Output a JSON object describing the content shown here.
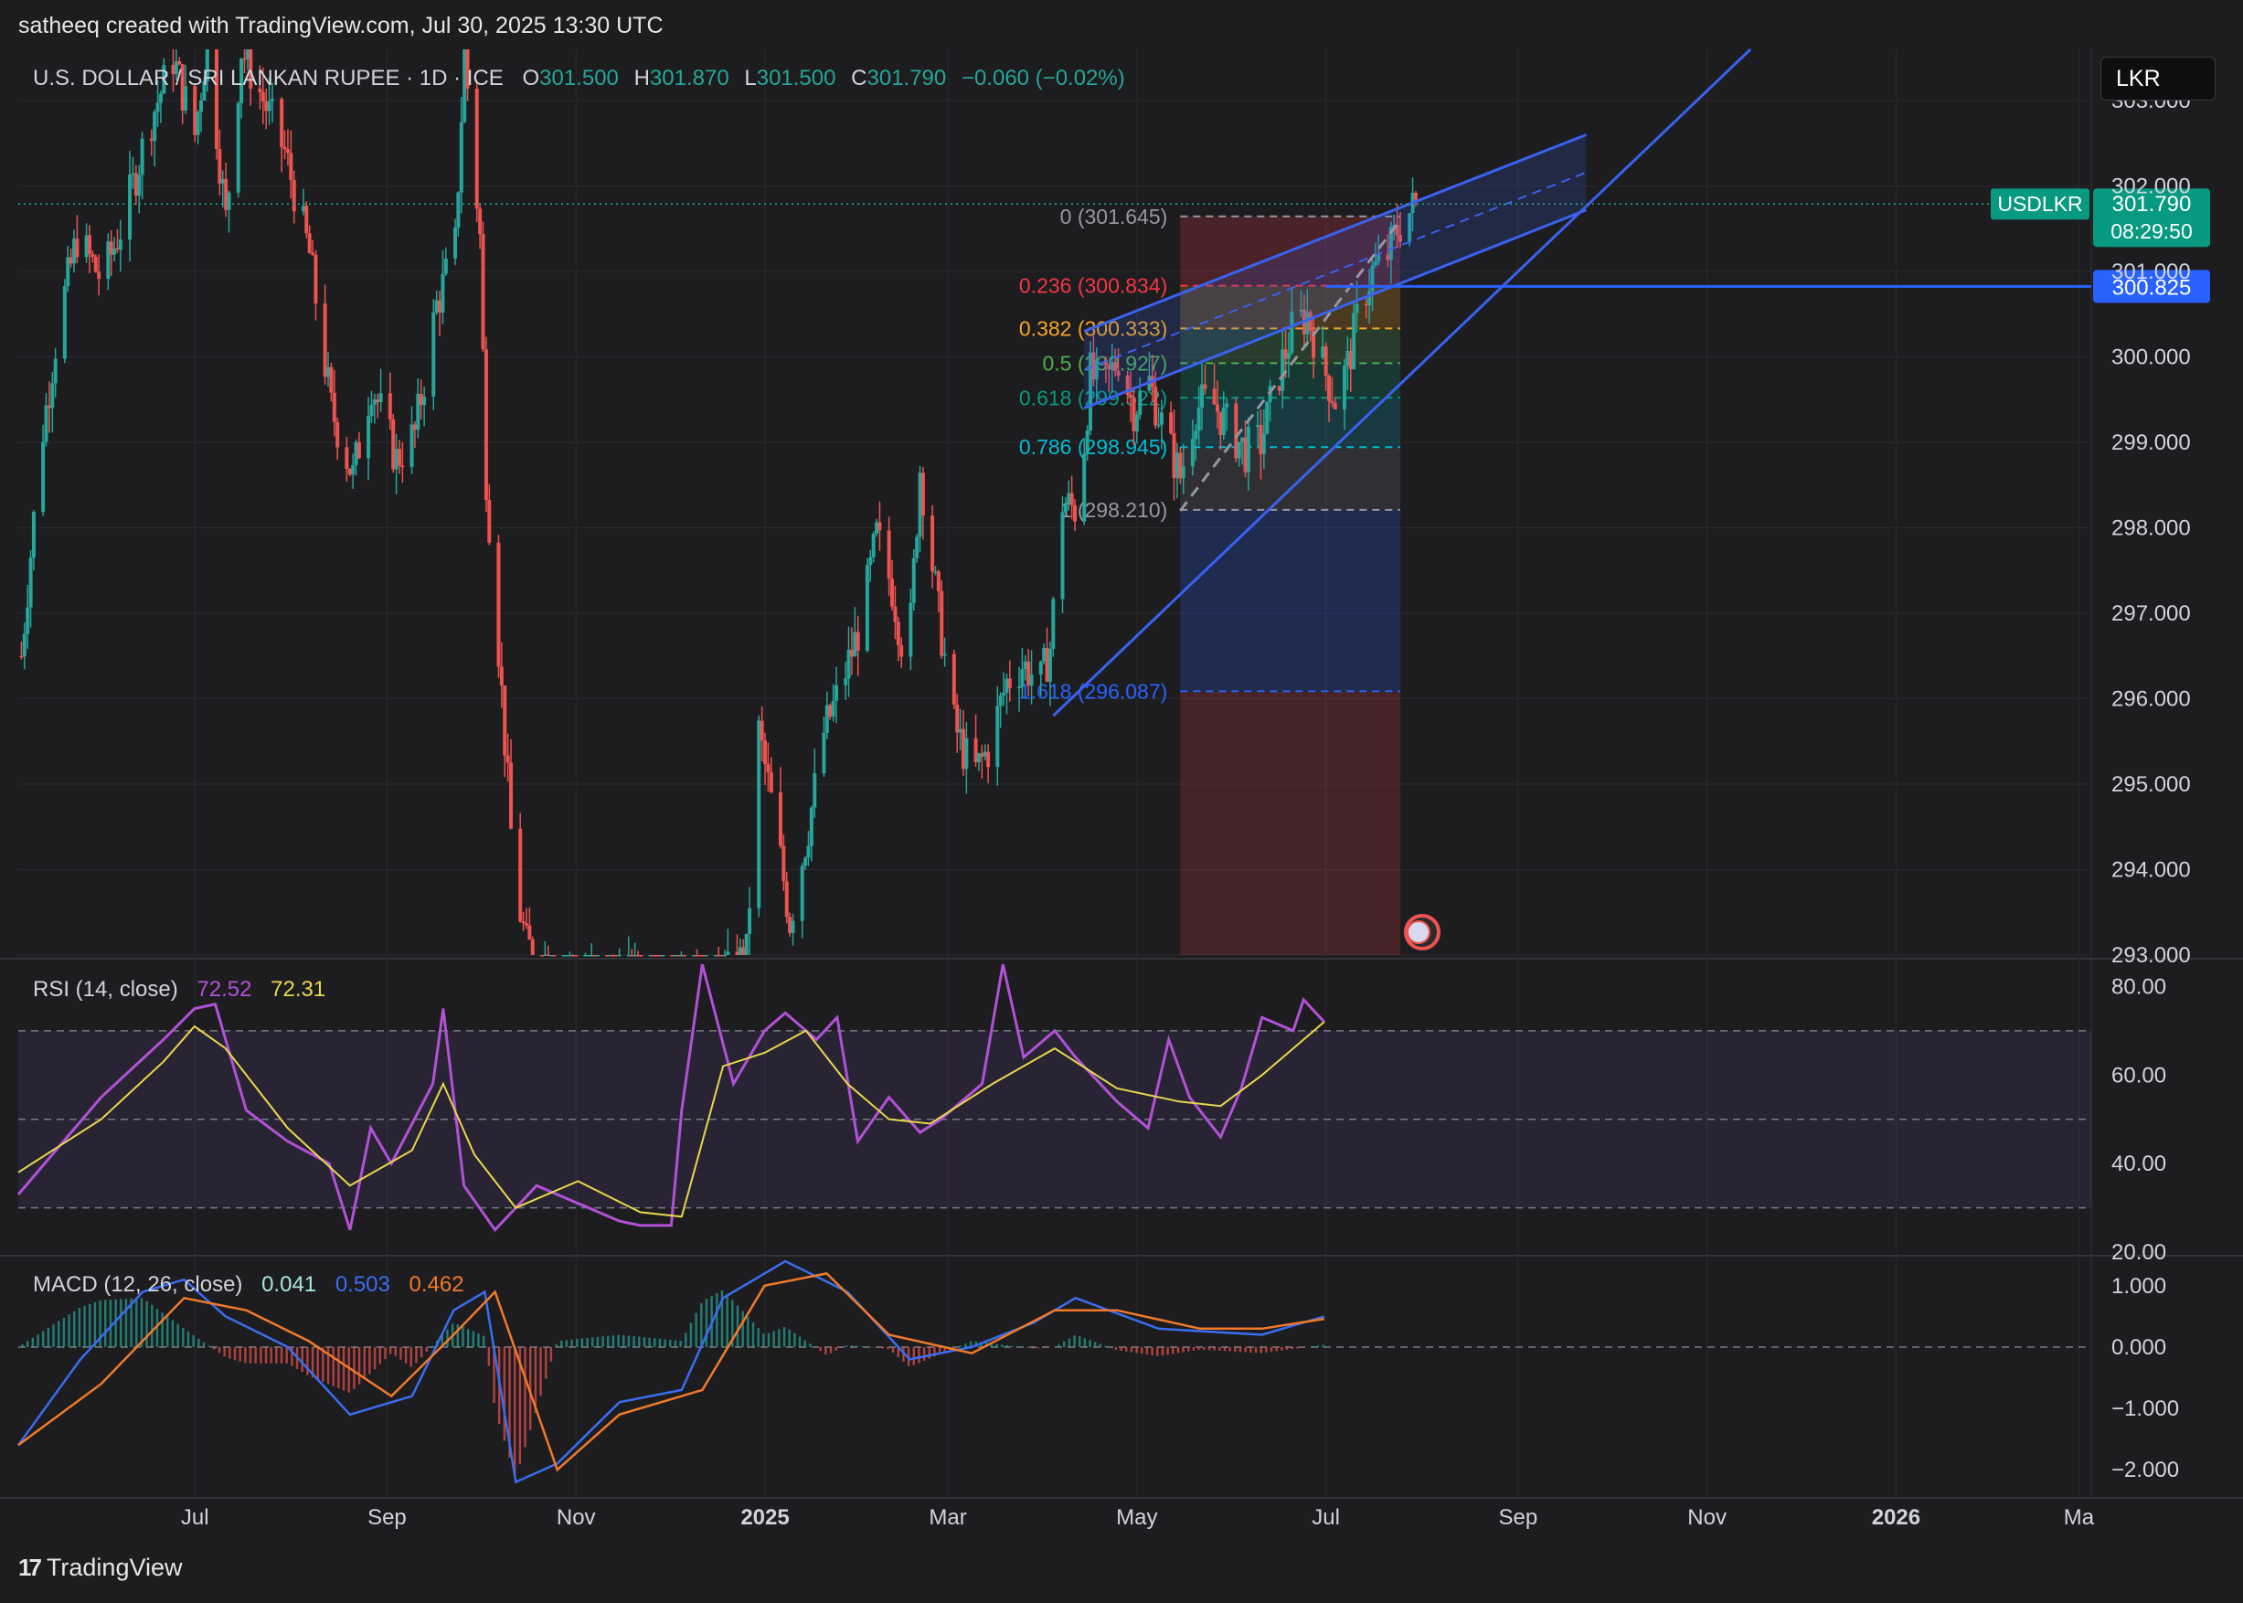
{
  "header": {
    "credit": "satheeq created with TradingView.com, Jul 30, 2025 13:30 UTC",
    "symbol_title": "U.S. DOLLAR / SRI LANKAN RUPEE · 1D · ICE",
    "o_label": "O",
    "o_value": "301.500",
    "h_label": "H",
    "h_value": "301.870",
    "l_label": "L",
    "l_value": "301.500",
    "c_label": "C",
    "c_value": "301.790",
    "change": "−0.060 (−0.02%)"
  },
  "currency_button": "LKR",
  "brand": {
    "logo": "17",
    "name": "TradingView"
  },
  "colors": {
    "background": "#1d1d1f",
    "up": "#26a69a",
    "down": "#ef5350",
    "channel": "#3a62f0",
    "rsi": "#b152d6",
    "rsi_ma": "#e8d84a",
    "macd": "#3a6df0",
    "signal": "#f07a2a"
  },
  "chart_data": [
    {
      "type": "candlestick",
      "panel": "price",
      "title": "U.S. DOLLAR / SRI LANKAN RUPEE · 1D · ICE",
      "ylim": [
        293.0,
        303.6
      ],
      "y_ticks": [
        "303.000",
        "302.000",
        "301.000",
        "300.000",
        "299.000",
        "298.000",
        "297.000",
        "296.000",
        "295.000",
        "294.000",
        "293.000"
      ],
      "x_range": [
        "2024-05-05",
        "2026-03-05"
      ],
      "x_ticks": [
        {
          "label": "Jul",
          "date": "2024-07-01"
        },
        {
          "label": "Sep",
          "date": "2024-09-01"
        },
        {
          "label": "Nov",
          "date": "2024-11-01"
        },
        {
          "label": "2025",
          "date": "2025-01-01",
          "bold": true
        },
        {
          "label": "Mar",
          "date": "2025-03-01"
        },
        {
          "label": "May",
          "date": "2025-05-01"
        },
        {
          "label": "Jul",
          "date": "2025-07-01"
        },
        {
          "label": "Sep",
          "date": "2025-09-01"
        },
        {
          "label": "Nov",
          "date": "2025-11-01"
        },
        {
          "label": "2026",
          "date": "2026-01-01",
          "bold": true
        },
        {
          "label": "Ma",
          "date": "2026-03-01"
        }
      ],
      "close_path": [
        [
          "2024-05-06",
          296.5
        ],
        [
          "2024-05-12",
          298.9
        ],
        [
          "2024-05-18",
          300.4
        ],
        [
          "2024-05-24",
          301.4
        ],
        [
          "2024-06-01",
          300.9
        ],
        [
          "2024-06-08",
          301.6
        ],
        [
          "2024-06-16",
          302.7
        ],
        [
          "2024-06-24",
          303.5
        ],
        [
          "2024-07-01",
          302.6
        ],
        [
          "2024-07-05",
          303.7
        ],
        [
          "2024-07-11",
          301.6
        ],
        [
          "2024-07-16",
          303.6
        ],
        [
          "2024-07-22",
          303.1
        ],
        [
          "2024-07-30",
          302.4
        ],
        [
          "2024-08-07",
          301.2
        ],
        [
          "2024-08-14",
          299.4
        ],
        [
          "2024-08-21",
          298.6
        ],
        [
          "2024-08-27",
          299.7
        ],
        [
          "2024-09-04",
          298.8
        ],
        [
          "2024-09-10",
          299.1
        ],
        [
          "2024-09-17",
          300.6
        ],
        [
          "2024-09-23",
          301.3
        ],
        [
          "2024-09-26",
          303.6
        ],
        [
          "2024-10-01",
          301.4
        ],
        [
          "2024-10-03",
          298.6
        ],
        [
          "2024-10-07",
          296.6
        ],
        [
          "2024-10-12",
          293.9
        ],
        [
          "2024-10-16",
          293.1
        ],
        [
          "2024-11-01",
          292.8
        ],
        [
          "2024-12-15",
          292.6
        ],
        [
          "2024-12-26",
          293.0
        ],
        [
          "2024-12-30",
          295.6
        ],
        [
          "2025-01-04",
          294.6
        ],
        [
          "2025-01-09",
          293.4
        ],
        [
          "2025-01-15",
          294.5
        ],
        [
          "2025-01-20",
          295.6
        ],
        [
          "2025-01-26",
          296.2
        ],
        [
          "2025-02-01",
          296.9
        ],
        [
          "2025-02-06",
          297.9
        ],
        [
          "2025-02-11",
          297.3
        ],
        [
          "2025-02-16",
          296.3
        ],
        [
          "2025-02-20",
          298.7
        ],
        [
          "2025-02-26",
          297.0
        ],
        [
          "2025-03-03",
          295.7
        ],
        [
          "2025-03-09",
          295.1
        ],
        [
          "2025-03-14",
          295.4
        ],
        [
          "2025-03-20",
          296.2
        ],
        [
          "2025-03-25",
          296.4
        ],
        [
          "2025-03-31",
          296.2
        ],
        [
          "2025-04-03",
          296.6
        ],
        [
          "2025-04-07",
          298.3
        ],
        [
          "2025-04-12",
          298.2
        ],
        [
          "2025-04-16",
          299.8
        ],
        [
          "2025-04-20",
          299.6
        ],
        [
          "2025-04-25",
          300.0
        ],
        [
          "2025-04-30",
          299.4
        ],
        [
          "2025-05-05",
          299.7
        ],
        [
          "2025-05-10",
          299.1
        ],
        [
          "2025-05-15",
          298.6
        ],
        [
          "2025-05-20",
          299.4
        ],
        [
          "2025-05-25",
          299.5
        ],
        [
          "2025-05-30",
          299.2
        ],
        [
          "2025-06-05",
          298.9
        ],
        [
          "2025-06-10",
          299.0
        ],
        [
          "2025-06-15",
          299.7
        ],
        [
          "2025-06-20",
          300.3
        ],
        [
          "2025-06-25",
          300.5
        ],
        [
          "2025-06-30",
          299.9
        ],
        [
          "2025-07-04",
          299.5
        ],
        [
          "2025-07-08",
          299.9
        ],
        [
          "2025-07-12",
          300.6
        ],
        [
          "2025-07-16",
          301.0
        ],
        [
          "2025-07-20",
          301.1
        ],
        [
          "2025-07-24",
          301.5
        ],
        [
          "2025-07-30",
          301.79
        ]
      ],
      "last_price": {
        "symbol": "USDLKR",
        "price": "301.790",
        "countdown": "08:29:50"
      },
      "horizontal_level": {
        "price": "300.825"
      },
      "fibonacci": {
        "from_date": "2025-05-15",
        "to_date": "2025-07-25",
        "levels": [
          {
            "ratio": "0",
            "price": "301.645",
            "value": 301.645,
            "color": "#9598a1"
          },
          {
            "ratio": "0.236",
            "price": "300.834",
            "value": 300.834,
            "color": "#f23645"
          },
          {
            "ratio": "0.382",
            "price": "300.333",
            "value": 300.333,
            "color": "#f5a623"
          },
          {
            "ratio": "0.5",
            "price": "299.927",
            "value": 299.927,
            "color": "#4caf50"
          },
          {
            "ratio": "0.618",
            "price": "299.522",
            "value": 299.522,
            "color": "#089981"
          },
          {
            "ratio": "0.786",
            "price": "298.945",
            "value": 298.945,
            "color": "#00bcd4"
          },
          {
            "ratio": "1",
            "price": "298.210",
            "value": 298.21,
            "color": "#9598a1"
          },
          {
            "ratio": "1.618",
            "price": "296.087",
            "value": 296.087,
            "color": "#2962ff"
          }
        ]
      },
      "channel_lines": [
        {
          "from": [
            "2025-04-14",
            299.4
          ],
          "to": [
            "2025-09-23",
            301.72
          ]
        },
        {
          "from": [
            "2025-04-14",
            300.3
          ],
          "to": [
            "2025-09-23",
            302.6
          ]
        },
        {
          "from": [
            "2025-04-04",
            295.8
          ],
          "to": [
            "2025-11-15",
            303.6
          ]
        }
      ]
    },
    {
      "type": "line",
      "panel": "rsi",
      "title": "RSI (14, close)",
      "ylim": [
        20,
        84
      ],
      "y_ticks": [
        "80.00",
        "60.00",
        "40.00",
        "20.00"
      ],
      "band": [
        30,
        70
      ],
      "series": [
        {
          "name": "72.52",
          "color": "#b152d6",
          "values": [
            [
              0,
              33
            ],
            [
              0.04,
              55
            ],
            [
              0.07,
              68
            ],
            [
              0.085,
              75
            ],
            [
              0.095,
              76
            ],
            [
              0.11,
              52
            ],
            [
              0.13,
              45
            ],
            [
              0.15,
              40
            ],
            [
              0.16,
              25
            ],
            [
              0.17,
              48
            ],
            [
              0.18,
              40
            ],
            [
              0.2,
              58
            ],
            [
              0.205,
              75
            ],
            [
              0.215,
              35
            ],
            [
              0.23,
              25
            ],
            [
              0.25,
              35
            ],
            [
              0.27,
              31
            ],
            [
              0.29,
              27
            ],
            [
              0.3,
              26
            ],
            [
              0.315,
              26
            ],
            [
              0.32,
              52
            ],
            [
              0.33,
              85
            ],
            [
              0.345,
              58
            ],
            [
              0.36,
              70
            ],
            [
              0.37,
              74
            ],
            [
              0.385,
              68
            ],
            [
              0.395,
              73
            ],
            [
              0.405,
              45
            ],
            [
              0.42,
              55
            ],
            [
              0.435,
              47
            ],
            [
              0.445,
              50
            ],
            [
              0.465,
              58
            ],
            [
              0.475,
              85
            ],
            [
              0.485,
              64
            ],
            [
              0.5,
              70
            ],
            [
              0.51,
              64
            ],
            [
              0.53,
              54
            ],
            [
              0.545,
              48
            ],
            [
              0.555,
              68
            ],
            [
              0.565,
              55
            ],
            [
              0.58,
              46
            ],
            [
              0.59,
              57
            ],
            [
              0.6,
              73
            ],
            [
              0.615,
              70
            ],
            [
              0.62,
              77
            ],
            [
              0.63,
              72
            ]
          ]
        },
        {
          "name": "72.31",
          "color": "#e8d84a",
          "values": [
            [
              0,
              38
            ],
            [
              0.04,
              50
            ],
            [
              0.07,
              63
            ],
            [
              0.085,
              71
            ],
            [
              0.1,
              66
            ],
            [
              0.13,
              48
            ],
            [
              0.16,
              35
            ],
            [
              0.19,
              43
            ],
            [
              0.205,
              58
            ],
            [
              0.22,
              42
            ],
            [
              0.24,
              30
            ],
            [
              0.27,
              36
            ],
            [
              0.3,
              29
            ],
            [
              0.32,
              28
            ],
            [
              0.34,
              62
            ],
            [
              0.36,
              65
            ],
            [
              0.38,
              70
            ],
            [
              0.4,
              58
            ],
            [
              0.42,
              50
            ],
            [
              0.44,
              49
            ],
            [
              0.47,
              58
            ],
            [
              0.5,
              66
            ],
            [
              0.53,
              57
            ],
            [
              0.56,
              54
            ],
            [
              0.58,
              53
            ],
            [
              0.6,
              60
            ],
            [
              0.62,
              68
            ],
            [
              0.63,
              72
            ]
          ]
        }
      ]
    },
    {
      "type": "line",
      "panel": "macd",
      "title": "MACD (12, 26, close)",
      "ylim": [
        -2.4,
        1.4
      ],
      "y_ticks": [
        "1.000",
        "0.000",
        "−1.000",
        "−2.000"
      ],
      "series": [
        {
          "name": "0.041",
          "role": "histogram",
          "color": "#26a69a"
        },
        {
          "name": "0.503",
          "color": "#3a6df0",
          "values": [
            [
              0,
              -1.6
            ],
            [
              0.03,
              -0.2
            ],
            [
              0.06,
              0.9
            ],
            [
              0.08,
              1.1
            ],
            [
              0.1,
              0.5
            ],
            [
              0.13,
              0
            ],
            [
              0.16,
              -1.1
            ],
            [
              0.19,
              -0.8
            ],
            [
              0.21,
              0.6
            ],
            [
              0.225,
              0.9
            ],
            [
              0.24,
              -2.2
            ],
            [
              0.26,
              -1.9
            ],
            [
              0.29,
              -0.9
            ],
            [
              0.32,
              -0.7
            ],
            [
              0.34,
              0.8
            ],
            [
              0.37,
              1.4
            ],
            [
              0.4,
              0.9
            ],
            [
              0.43,
              -0.2
            ],
            [
              0.46,
              0
            ],
            [
              0.49,
              0.4
            ],
            [
              0.51,
              0.8
            ],
            [
              0.55,
              0.3
            ],
            [
              0.6,
              0.2
            ],
            [
              0.63,
              0.5
            ]
          ]
        },
        {
          "name": "0.462",
          "color": "#f07a2a",
          "values": [
            [
              0,
              -1.6
            ],
            [
              0.04,
              -0.6
            ],
            [
              0.08,
              0.8
            ],
            [
              0.11,
              0.6
            ],
            [
              0.14,
              0.1
            ],
            [
              0.18,
              -0.8
            ],
            [
              0.21,
              0.2
            ],
            [
              0.23,
              0.9
            ],
            [
              0.26,
              -2
            ],
            [
              0.29,
              -1.1
            ],
            [
              0.33,
              -0.7
            ],
            [
              0.36,
              1.0
            ],
            [
              0.39,
              1.2
            ],
            [
              0.42,
              0.2
            ],
            [
              0.46,
              -0.1
            ],
            [
              0.5,
              0.6
            ],
            [
              0.53,
              0.6
            ],
            [
              0.57,
              0.3
            ],
            [
              0.6,
              0.3
            ],
            [
              0.63,
              0.46
            ]
          ]
        }
      ]
    }
  ]
}
